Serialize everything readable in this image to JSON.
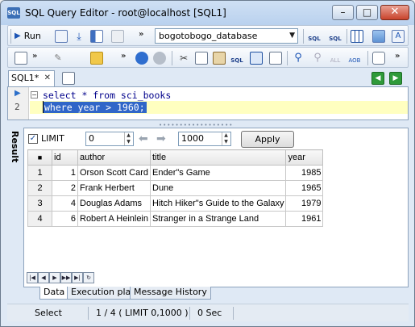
{
  "window": {
    "title": "SQL Query Editor - root@localhost [SQL1]",
    "app_icon_text": "SQL",
    "min_glyph": "–",
    "max_glyph": "□",
    "close_glyph": "✕"
  },
  "toolbar1": {
    "run_label": "Run",
    "database": "bogotobogo_database",
    "overflow": "»"
  },
  "toolbar2": {
    "overflow": "»"
  },
  "tabs": {
    "active_tab": "SQL1*",
    "close_glyph": "✕"
  },
  "editor": {
    "line_numbers": [
      "1",
      "2"
    ],
    "line1": "select * from sci_books",
    "line2": "where year > 1960;"
  },
  "result": {
    "side_label": "Result",
    "limit_checked": true,
    "limit_label": "LIMIT",
    "offset_value": "0",
    "limit_value": "1000",
    "apply_label": "Apply",
    "columns": [
      "id",
      "author",
      "title",
      "year"
    ],
    "rows": [
      {
        "n": "1",
        "id": "1",
        "author": "Orson Scott Card",
        "title": "Ender\"s Game",
        "year": "1985"
      },
      {
        "n": "2",
        "id": "2",
        "author": "Frank Herbert",
        "title": "Dune",
        "year": "1965"
      },
      {
        "n": "3",
        "id": "4",
        "author": "Douglas Adams",
        "title": "Hitch Hiker\"s Guide to the Galaxy",
        "year": "1979"
      },
      {
        "n": "4",
        "id": "6",
        "author": "Robert A Heinlein",
        "title": "Stranger in a Strange Land",
        "year": "1961"
      }
    ],
    "bottom_tabs": [
      "Data",
      "Execution plan",
      "Message History"
    ]
  },
  "status": {
    "mode": "Select",
    "rows_info": "1 / 4 ( LIMIT 0,1000 )",
    "time": "0 Sec"
  },
  "colors": {
    "selection": "#3066c8",
    "keyword": "#00008b",
    "current_line": "#ffffc0",
    "nav_green": "#2f9a3a"
  }
}
